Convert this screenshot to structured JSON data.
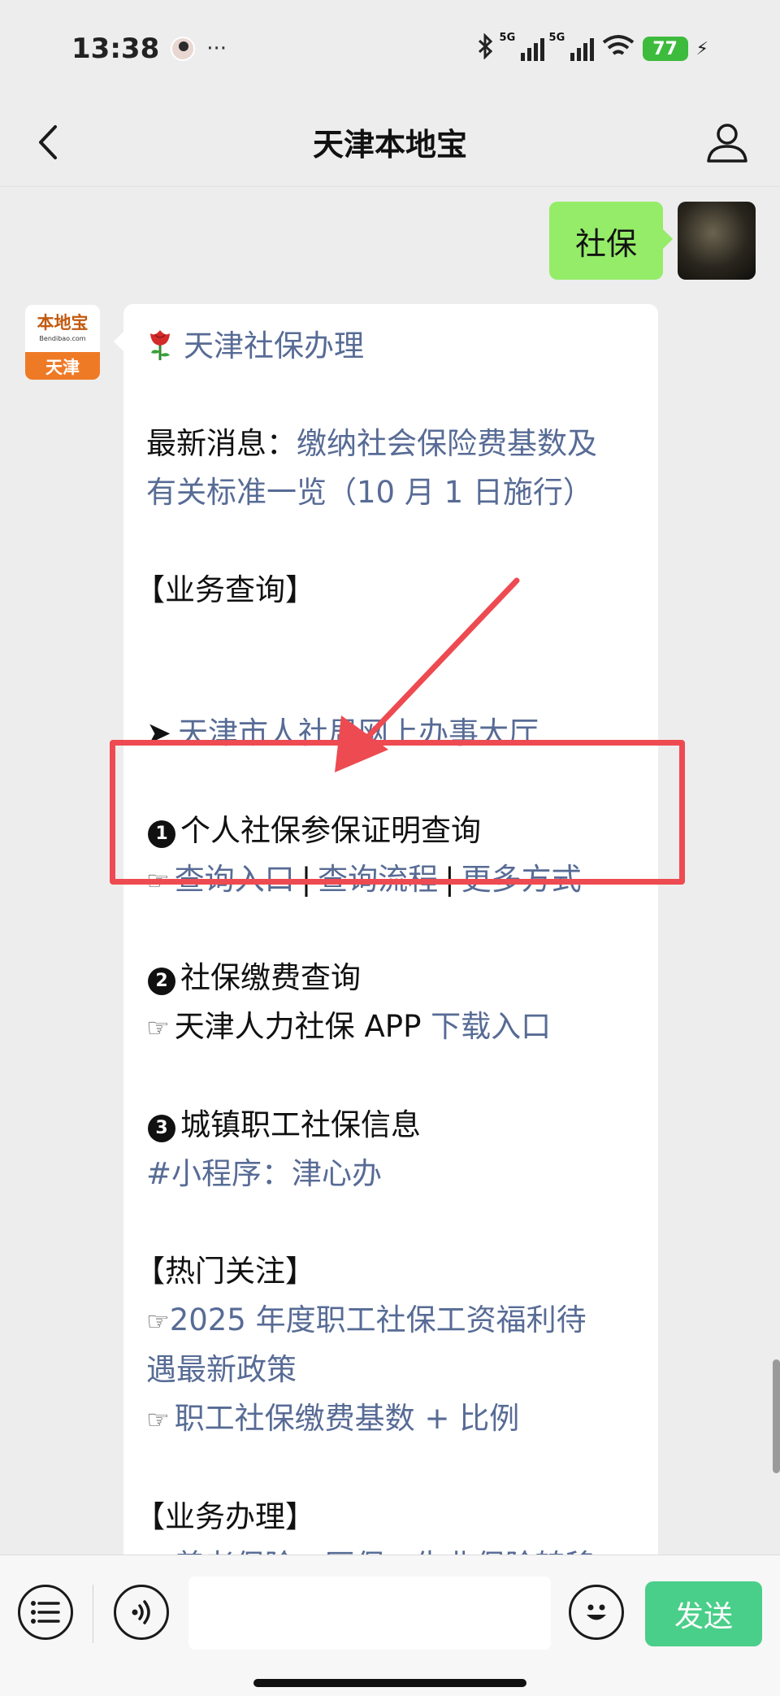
{
  "status_bar": {
    "time": "13:38",
    "more": "···",
    "signal1_label": "5G",
    "signal2_label": "5G",
    "battery": "77"
  },
  "nav": {
    "title": "天津本地宝"
  },
  "user_message": {
    "text": "社保"
  },
  "bot_avatar": {
    "brand": "本地宝",
    "url": "Bendibao.com",
    "city": "天津"
  },
  "bot_message": {
    "header": "天津社保办理",
    "news_label": "最新消息：",
    "news_link_line1": "缴纳社会保险费基数及",
    "news_link_line2": "有关标准一览（10 月 1 日施行）",
    "section_query": "【业务查询】",
    "hall_arrow": "➤",
    "hall_link": "天津市人社局网上办事大厅",
    "item1_num": "1",
    "item1_title": "个人社保参保证明查询",
    "item1_hand": "☞",
    "item1_link_a": "查询入口",
    "item1_sep1": "|",
    "item1_link_b": "查询流程",
    "item1_sep2": "|",
    "item1_link_c": "更多方式",
    "item2_num": "2",
    "item2_title": "社保缴费查询",
    "item2_hand": "☞",
    "item2_text": "天津人力社保 APP",
    "item2_link": "下载入口",
    "item3_num": "3",
    "item3_title": "城镇职工社保信息",
    "item3_link": "#小程序：津心办",
    "section_hot": "【热门关注】",
    "hot1_hand": "☞",
    "hot1_link_line1": "2025 年度职工社保工资福利待",
    "hot1_link_line2": "遇最新政策",
    "hot2_hand": "☞",
    "hot2_link": "职工社保缴费基数 + 比例",
    "section_business": "【业务办理】",
    "biz1_hand": "☞",
    "biz1_link": "养老保险、医保、失业保险转移"
  },
  "input_bar": {
    "send_label": "发送"
  },
  "colors": {
    "link": "#576b95",
    "user_bubble": "#95ec69",
    "send_button": "#07c160",
    "annotation": "#ee4a51"
  }
}
